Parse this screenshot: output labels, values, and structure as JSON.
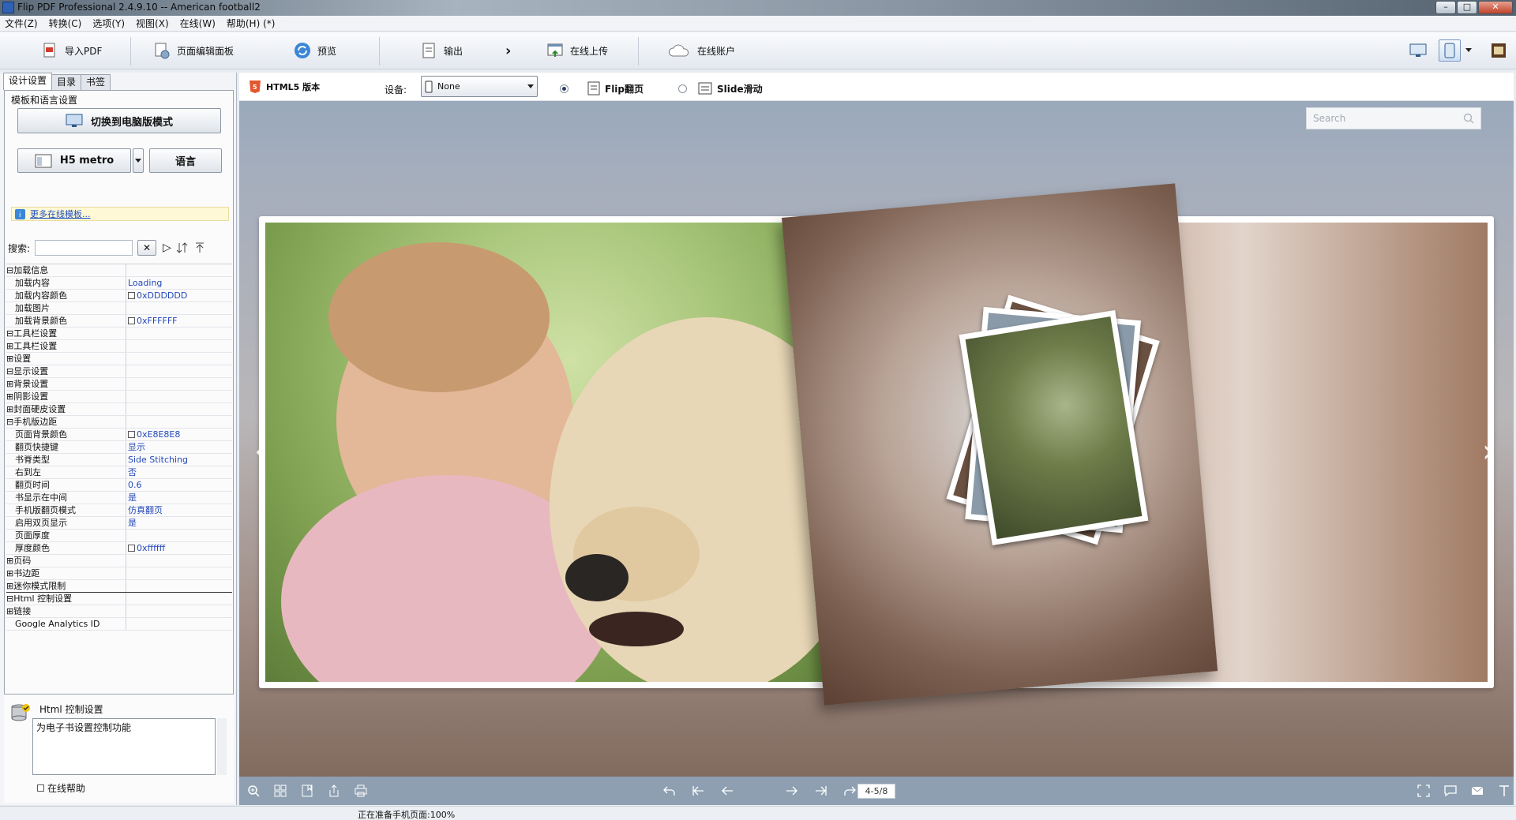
{
  "window": {
    "title": "Flip PDF Professional 2.4.9.10 -- American football2"
  },
  "menu": [
    "文件(Z)",
    "转换(C)",
    "选项(Y)",
    "视图(X)",
    "在线(W)",
    "帮助(H) (*)"
  ],
  "toolbar": {
    "import_pdf": "导入PDF",
    "page_editor": "页面编辑面板",
    "preview": "预览",
    "output": "输出",
    "upload": "在线上传",
    "account": "在线账户"
  },
  "left": {
    "tabs": [
      "设计设置",
      "目录",
      "书签"
    ],
    "group_label": "模板和语言设置",
    "switch_btn": "切换到电脑版模式",
    "template_btn": "H5 metro",
    "language_btn": "语言",
    "more_templates": "更多在线模板...",
    "search_label": "搜索:",
    "properties": [
      {
        "key": "⊟加载信息",
        "value": "",
        "check": false
      },
      {
        "key": "　加载内容",
        "value": "Loading",
        "check": false
      },
      {
        "key": "　加载内容颜色",
        "value": "0xDDDDDD",
        "check": true
      },
      {
        "key": "　加载图片",
        "value": "",
        "check": false
      },
      {
        "key": "　加载背景颜色",
        "value": "0xFFFFFF",
        "check": true
      },
      {
        "key": "⊟工具栏设置",
        "value": "",
        "check": false
      },
      {
        "key": " ⊞工具栏设置",
        "value": "",
        "check": false
      },
      {
        "key": " ⊞设置",
        "value": "",
        "check": false
      },
      {
        "key": "⊟显示设置",
        "value": "",
        "check": false
      },
      {
        "key": " ⊞背景设置",
        "value": "",
        "check": false
      },
      {
        "key": " ⊞阴影设置",
        "value": "",
        "check": false
      },
      {
        "key": " ⊞封面硬皮设置",
        "value": "",
        "check": false
      },
      {
        "key": " ⊟手机版边距",
        "value": "",
        "check": false
      },
      {
        "key": "　页面背景颜色",
        "value": "0xE8E8E8",
        "check": true
      },
      {
        "key": "　翻页快捷键",
        "value": "显示",
        "check": false
      },
      {
        "key": "　书脊类型",
        "value": "Side Stitching",
        "check": false
      },
      {
        "key": "　右到左",
        "value": "否",
        "check": false
      },
      {
        "key": "　翻页时间",
        "value": "0.6",
        "check": false
      },
      {
        "key": "　书显示在中间",
        "value": "是",
        "check": false
      },
      {
        "key": "　手机版翻页模式",
        "value": "仿真翻页",
        "check": false
      },
      {
        "key": "　启用双页显示",
        "value": "是",
        "check": false
      },
      {
        "key": "　页面厚度",
        "value": "",
        "check": false
      },
      {
        "key": "　厚度颜色",
        "value": "0xffffff",
        "check": true
      },
      {
        "key": " ⊞页码",
        "value": "",
        "check": false
      },
      {
        "key": " ⊞书边距",
        "value": "",
        "check": false
      },
      {
        "key": " ⊞迷你模式限制",
        "value": "",
        "check": false
      },
      {
        "key": "⊟Html 控制设置",
        "value": "",
        "check": false
      },
      {
        "key": " ⊞链接",
        "value": "",
        "check": false
      },
      {
        "key": "　Google Analytics ID",
        "value": "",
        "check": false
      }
    ],
    "help_title": "Html 控制设置",
    "help_desc": "为电子书设置控制功能",
    "online_help": "在线帮助"
  },
  "right": {
    "html5_label": "HTML5 版本",
    "device_label": "设备:",
    "device_value": "None",
    "flip_label": "Flip翻页",
    "slide_label": "Slide滑动",
    "search_placeholder": "Search",
    "page_indicator": "4-5/8"
  },
  "status": {
    "text": "正在准备手机页面:100%"
  }
}
